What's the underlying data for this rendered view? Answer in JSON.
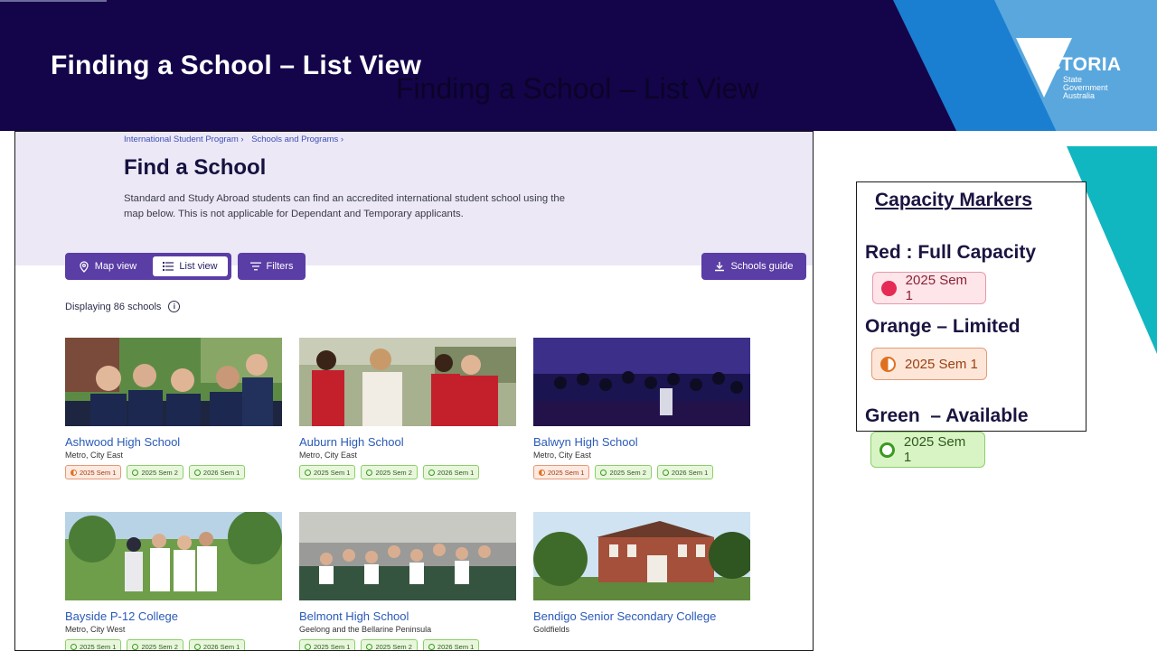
{
  "slide": {
    "title": "Finding a School – List View",
    "ghost_title": "Finding a School – List View",
    "logo": {
      "word": "VICTORIA",
      "sub": "State\nGovernment\nAustralia"
    }
  },
  "page": {
    "breadcrumbs": [
      "International Student Program ›",
      "Schools and Programs ›"
    ],
    "heading": "Find a School",
    "intro": "Standard and Study Abroad students can find an accredited international student school using the map below. This is not applicable for Dependant and Temporary applicants.",
    "toolbar": {
      "map_view": "Map view",
      "list_view": "List view",
      "filters": "Filters",
      "schools_guide": "Schools guide"
    },
    "displaying": "Displaying 86 schools",
    "schools": [
      {
        "name": "Ashwood High School",
        "region": "Metro, City East",
        "chips": [
          {
            "label": "2025 Sem 1",
            "status": "orange"
          },
          {
            "label": "2025 Sem 2",
            "status": "green"
          },
          {
            "label": "2026 Sem 1",
            "status": "green"
          }
        ]
      },
      {
        "name": "Auburn High School",
        "region": "Metro, City East",
        "chips": [
          {
            "label": "2025 Sem 1",
            "status": "green"
          },
          {
            "label": "2025 Sem 2",
            "status": "green"
          },
          {
            "label": "2026 Sem 1",
            "status": "green"
          }
        ]
      },
      {
        "name": "Balwyn High School",
        "region": "Metro, City East",
        "chips": [
          {
            "label": "2025 Sem 1",
            "status": "orange"
          },
          {
            "label": "2025 Sem 2",
            "status": "green"
          },
          {
            "label": "2026 Sem 1",
            "status": "green"
          }
        ]
      },
      {
        "name": "Bayside P-12 College",
        "region": "Metro, City West",
        "chips": [
          {
            "label": "2025 Sem 1",
            "status": "green"
          },
          {
            "label": "2025 Sem 2",
            "status": "green"
          },
          {
            "label": "2026 Sem 1",
            "status": "green"
          }
        ]
      },
      {
        "name": "Belmont High School",
        "region": "Geelong and the Bellarine Peninsula",
        "chips": [
          {
            "label": "2025 Sem 1",
            "status": "green"
          },
          {
            "label": "2025 Sem 2",
            "status": "green"
          },
          {
            "label": "2026 Sem 1",
            "status": "green"
          }
        ]
      },
      {
        "name": "Bendigo Senior Secondary College",
        "region": "Goldfields",
        "chips": []
      }
    ]
  },
  "legend": {
    "title": "Capacity Markers",
    "red_label": "Red : Full Capacity",
    "orange_label": "Orange – Limited",
    "green_label": "Green  – Available",
    "chip_label": "2025 Sem 1"
  },
  "colors": {
    "navy": "#14044a",
    "purple_button": "#5a3da5",
    "link_blue": "#2a5ab8",
    "teal": "#11b7c0"
  }
}
